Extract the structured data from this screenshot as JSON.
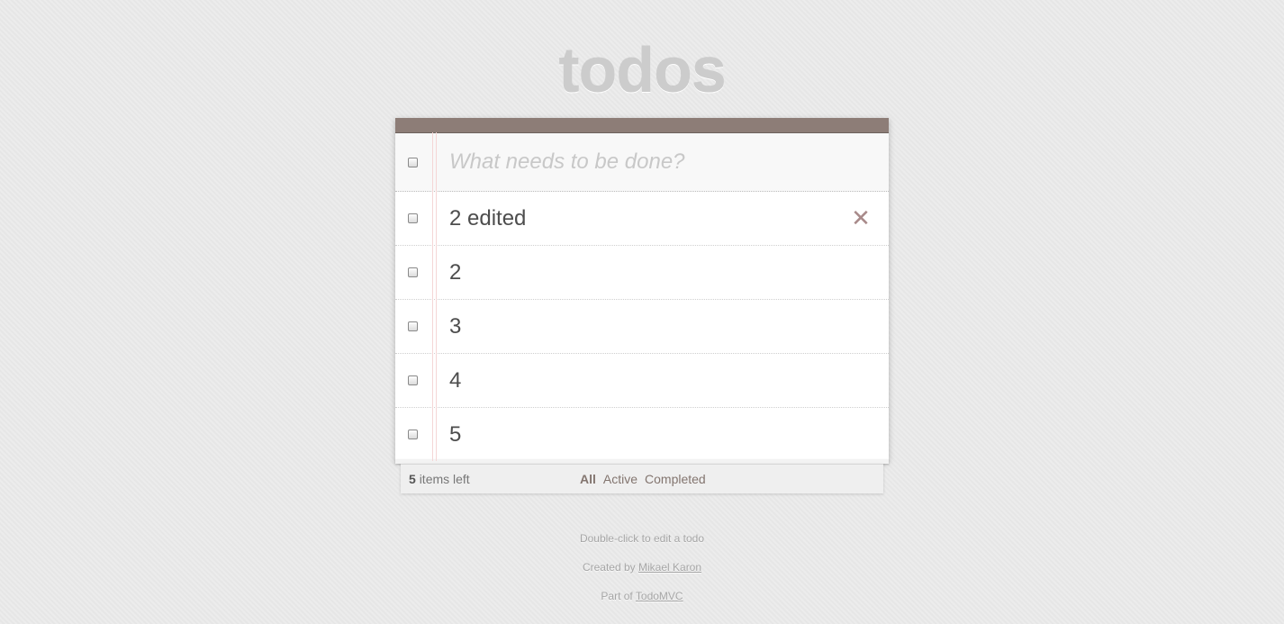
{
  "app": {
    "title": "todos"
  },
  "new_todo": {
    "placeholder": "What needs to be done?",
    "value": ""
  },
  "todos": [
    {
      "label": "2 edited",
      "completed": false,
      "show_destroy": true
    },
    {
      "label": "2",
      "completed": false,
      "show_destroy": false
    },
    {
      "label": "3",
      "completed": false,
      "show_destroy": false
    },
    {
      "label": "4",
      "completed": false,
      "show_destroy": false
    },
    {
      "label": "5",
      "completed": false,
      "show_destroy": false
    }
  ],
  "footer": {
    "count": "5",
    "count_suffix": "items left",
    "filters": [
      {
        "label": "All",
        "selected": true
      },
      {
        "label": "Active",
        "selected": false
      },
      {
        "label": "Completed",
        "selected": false
      }
    ]
  },
  "info": {
    "hint": "Double-click to edit a todo",
    "created_prefix": "Created by",
    "author": "Mikael Karon",
    "part_prefix": "Part of",
    "project": "TodoMVC"
  },
  "icons": {
    "destroy": "close-icon"
  },
  "colors": {
    "header_bar": "#8d7d77",
    "title": "#cccccc",
    "destroy": "#a88a8a",
    "filter_link": "#83756f"
  }
}
